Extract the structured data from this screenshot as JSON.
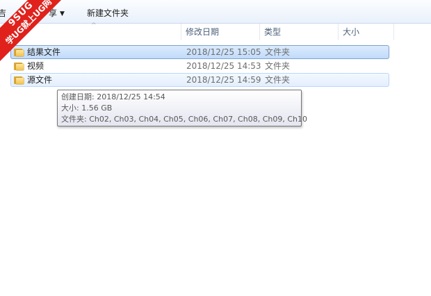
{
  "toolbar": {
    "partial_left_label": "吉",
    "share_label": "享",
    "share_arrow": "▼",
    "new_folder_label": "新建文件夹"
  },
  "columns": {
    "name": "",
    "date": "修改日期",
    "type": "类型",
    "size": "大小",
    "sort_glyph": "^"
  },
  "files": [
    {
      "name": "结果文件",
      "date": "2018/12/25 15:05",
      "type": "文件夹",
      "size": "",
      "state": "selected"
    },
    {
      "name": "视频",
      "date": "2018/12/25 14:53",
      "type": "文件夹",
      "size": "",
      "state": "normal"
    },
    {
      "name": "源文件",
      "date": "2018/12/25 14:59",
      "type": "文件夹",
      "size": "",
      "state": "hover"
    }
  ],
  "tooltip": {
    "created": "创建日期: 2018/12/25 14:54",
    "size": "大小: 1.56 GB",
    "folders": "文件夹: Ch02, Ch03, Ch04, Ch05, Ch06, Ch07, Ch08, Ch09, Ch10"
  },
  "watermark": {
    "top": "9SUG",
    "bottom": "学UG就上UG网"
  },
  "icons": {
    "folder": "folder-icon",
    "dropdown": "chevron-down-icon"
  }
}
